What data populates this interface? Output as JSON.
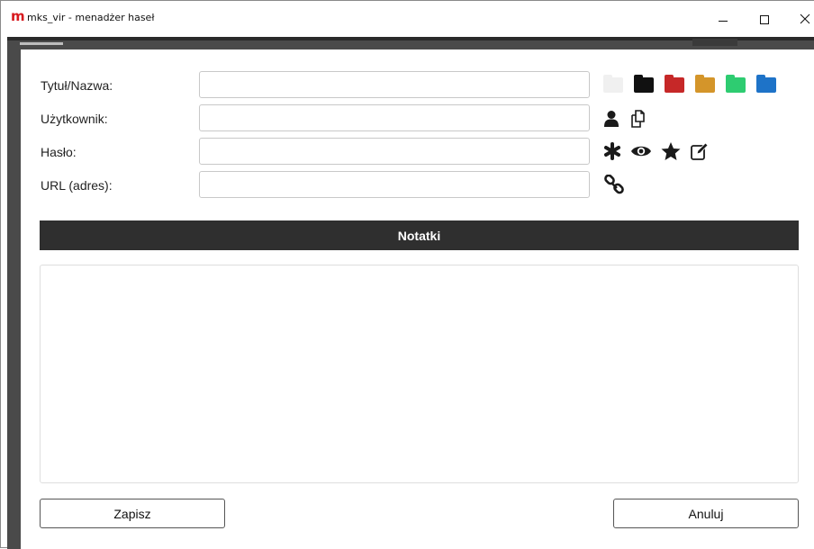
{
  "window": {
    "title": "mks_vir - menadżer haseł",
    "logo_letter": "m",
    "logo_color": "#d7191e"
  },
  "form": {
    "title_label": "Tytuł/Nazwa:",
    "title_value": "",
    "user_label": "Użytkownik:",
    "user_value": "",
    "password_label": "Hasło:",
    "password_value": "",
    "url_label": "URL (adres):",
    "url_value": ""
  },
  "folder_colors": [
    {
      "name": "folder-white",
      "color": "#f0f0f0"
    },
    {
      "name": "folder-black",
      "color": "#111111"
    },
    {
      "name": "folder-red",
      "color": "#c62828"
    },
    {
      "name": "folder-orange",
      "color": "#d4952a"
    },
    {
      "name": "folder-green",
      "color": "#2ecc71"
    },
    {
      "name": "folder-blue",
      "color": "#1e73c8"
    }
  ],
  "icons": {
    "user_row": [
      "user-icon",
      "copy-icon"
    ],
    "password_row": [
      "asterisk-icon",
      "eye-icon",
      "star-icon",
      "edit-icon"
    ],
    "url_row": [
      "link-icon"
    ]
  },
  "notes": {
    "header": "Notatki",
    "value": ""
  },
  "buttons": {
    "save": "Zapisz",
    "cancel": "Anuluj"
  }
}
